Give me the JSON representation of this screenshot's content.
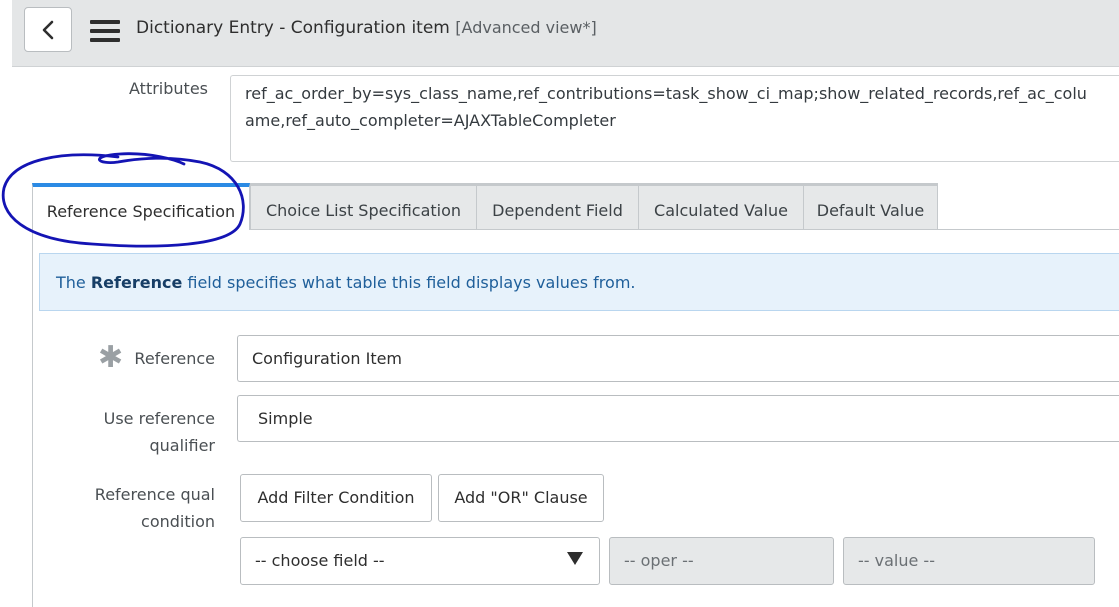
{
  "header": {
    "title": "Dictionary Entry - Configuration item",
    "view": "[Advanced view*]",
    "back_icon": "chevron-left-icon",
    "menu_icon": "hamburger-menu-icon"
  },
  "attributes": {
    "label": "Attributes",
    "line1": "ref_ac_order_by=sys_class_name,ref_contributions=task_show_ci_map;show_related_records,ref_ac_colu",
    "line2": "ame,ref_auto_completer=AJAXTableCompleter"
  },
  "tabs": [
    {
      "label": "Reference Specification",
      "active": true
    },
    {
      "label": "Choice List Specification"
    },
    {
      "label": "Dependent Field"
    },
    {
      "label": "Calculated Value"
    },
    {
      "label": "Default Value"
    }
  ],
  "info": {
    "prefix": "The ",
    "bold": "Reference",
    "suffix": " field specifies what table this field displays values from."
  },
  "form": {
    "reference": {
      "label": "Reference",
      "value": "Configuration Item",
      "required_icon": "asterisk-icon"
    },
    "use_qualifier": {
      "label_line1": "Use reference",
      "label_line2": "qualifier",
      "value": "Simple"
    },
    "qual_condition": {
      "label_line1": "Reference qual",
      "label_line2": "condition",
      "add_filter": "Add Filter Condition",
      "add_or": "Add \"OR\" Clause",
      "field_select": "-- choose field --",
      "oper": "-- oper --",
      "value": "-- value --"
    }
  },
  "colors": {
    "accent": "#2b8ae4",
    "annotation": "#1414b4",
    "info_bg": "#e7f2fb"
  }
}
